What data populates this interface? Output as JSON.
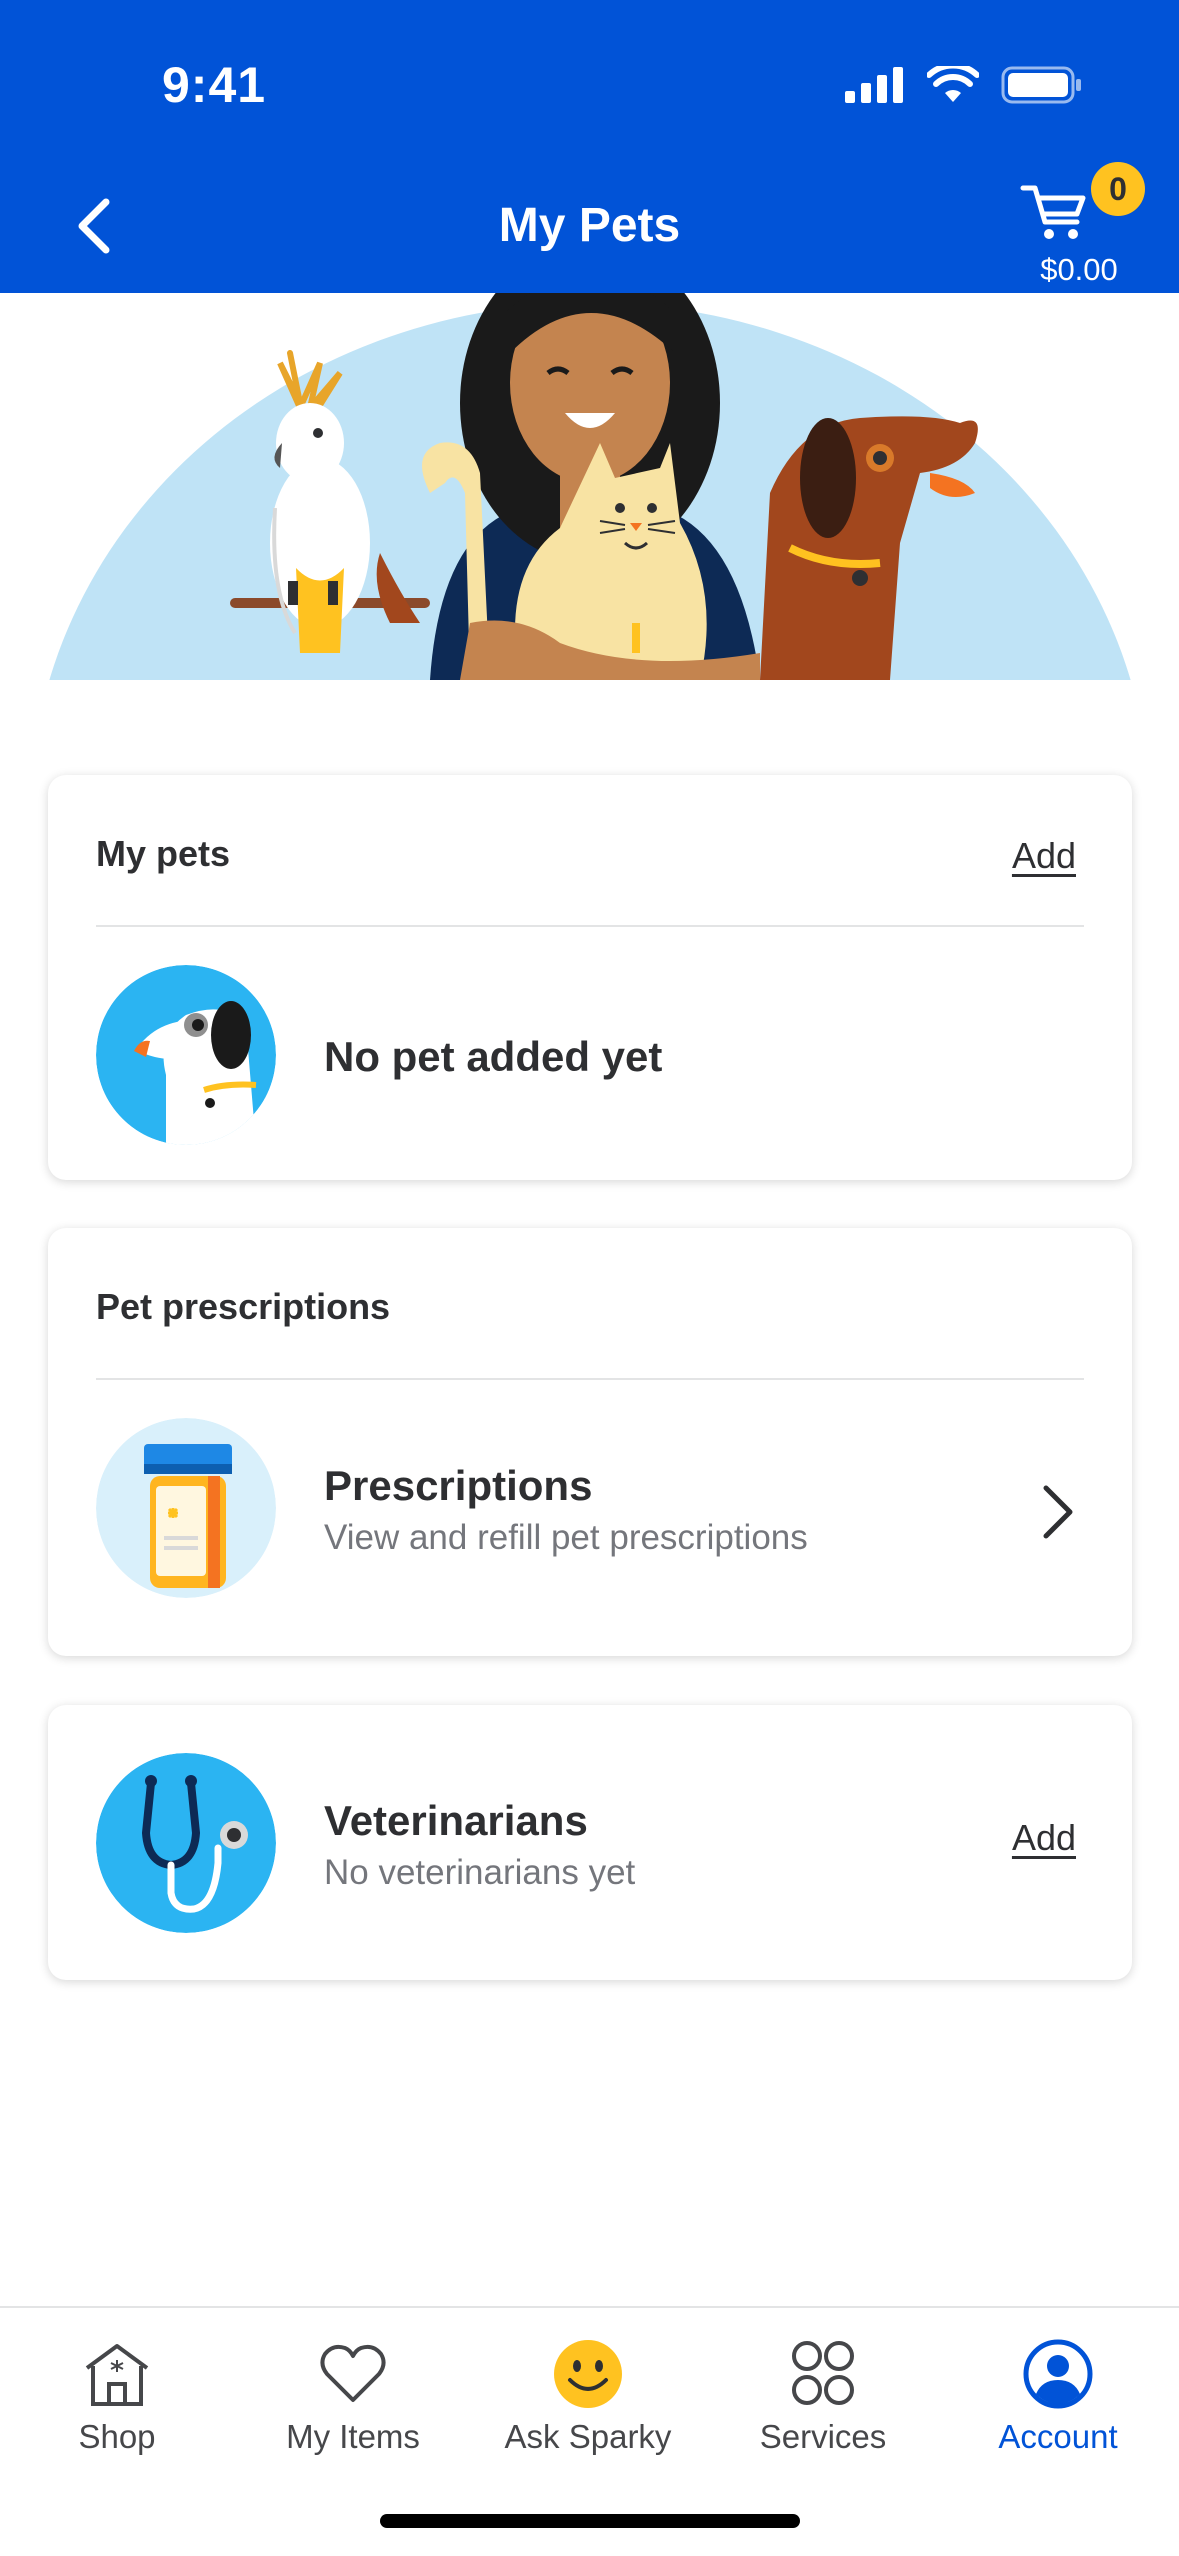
{
  "status_bar": {
    "time": "9:41"
  },
  "header": {
    "title": "My Pets",
    "cart_count": "0",
    "cart_total": "$0.00"
  },
  "my_pets_card": {
    "title": "My pets",
    "add_label": "Add",
    "empty_text": "No pet added yet"
  },
  "prescriptions_card": {
    "title": "Pet prescriptions",
    "item_title": "Prescriptions",
    "item_subtitle": "View and refill pet prescriptions"
  },
  "veterinarians_card": {
    "title": "Veterinarians",
    "subtitle": "No veterinarians yet",
    "add_label": "Add"
  },
  "bottom_nav": {
    "items": [
      {
        "label": "Shop",
        "icon": "store-icon",
        "active": false
      },
      {
        "label": "My Items",
        "icon": "heart-icon",
        "active": false
      },
      {
        "label": "Ask Sparky",
        "icon": "smiley-icon",
        "active": false
      },
      {
        "label": "Services",
        "icon": "grid-circles-icon",
        "active": false
      },
      {
        "label": "Account",
        "icon": "account-icon",
        "active": true
      }
    ]
  },
  "colors": {
    "brand_blue": "#0153d7",
    "spark_yellow": "#ffc220",
    "hero_bg": "#bfe3f6",
    "icon_blue": "#2bb4f2"
  }
}
